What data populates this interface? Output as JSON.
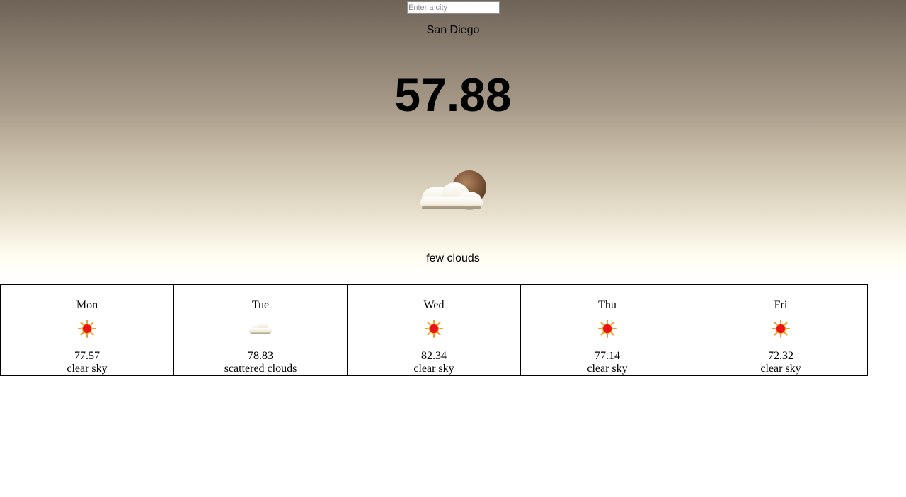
{
  "search": {
    "placeholder": "Enter a city",
    "value": ""
  },
  "current": {
    "city": "San Diego",
    "temperature": "57.88",
    "icon": "few-clouds-icon",
    "description": "few clouds"
  },
  "forecast": [
    {
      "day": "Mon",
      "icon": "sun-icon",
      "temp": "77.57",
      "description": "clear sky"
    },
    {
      "day": "Tue",
      "icon": "cloud-icon",
      "temp": "78.83",
      "description": "scattered clouds"
    },
    {
      "day": "Wed",
      "icon": "sun-icon",
      "temp": "82.34",
      "description": "clear sky"
    },
    {
      "day": "Thu",
      "icon": "sun-icon",
      "temp": "77.14",
      "description": "clear sky"
    },
    {
      "day": "Fri",
      "icon": "sun-icon",
      "temp": "72.32",
      "description": "clear sky"
    }
  ],
  "colors": {
    "gradient_top": "#6e6357",
    "gradient_bottom": "#ffffff",
    "sun_core": "#e8141a",
    "sun_rays": "#f59a1c"
  }
}
